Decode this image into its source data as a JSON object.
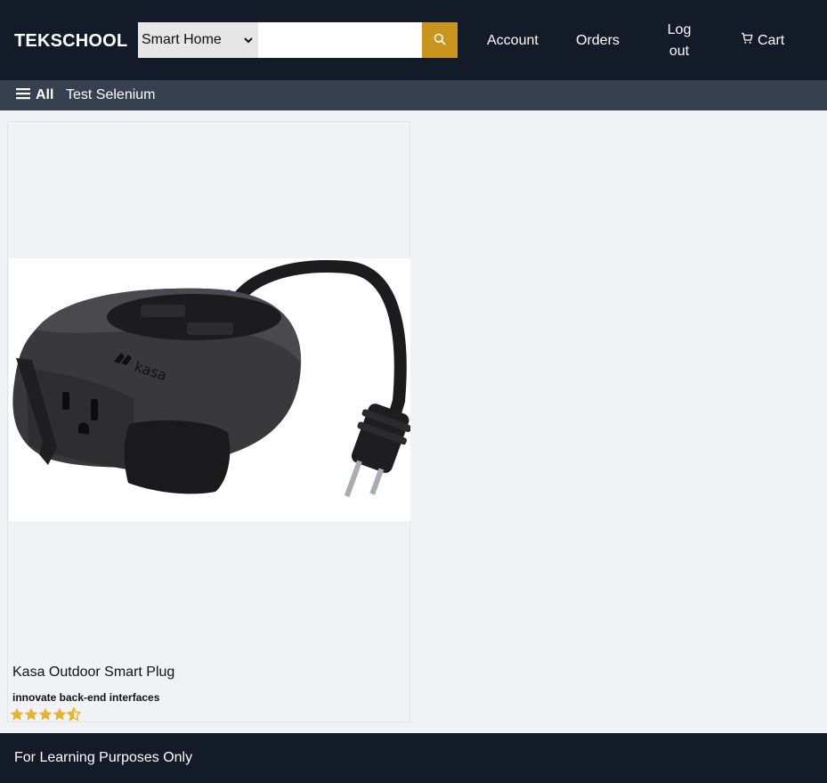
{
  "header": {
    "logo": "TEKSCHOOL",
    "search": {
      "category_selected": "Smart Home",
      "query": "",
      "placeholder": ""
    },
    "nav": {
      "account": "Account",
      "orders": "Orders",
      "logout": "Log out",
      "cart": "Cart"
    }
  },
  "sub_nav": {
    "all_label": "All",
    "link": "Test Selenium"
  },
  "product": {
    "name": "Kasa Outdoor Smart Plug",
    "description": "innovate back-end interfaces",
    "image_logo_text": "kasa",
    "rating": 4.5
  },
  "footer": {
    "text": "For Learning Purposes Only"
  },
  "colors": {
    "header_bg": "#131a28",
    "subnav_bg": "#37404f",
    "accent": "#c9951d",
    "star": "#e4b22c"
  },
  "icons": {
    "search": "search-icon",
    "cart": "cart-icon",
    "menu": "hamburger-icon",
    "select": "chevron-down-icon"
  }
}
